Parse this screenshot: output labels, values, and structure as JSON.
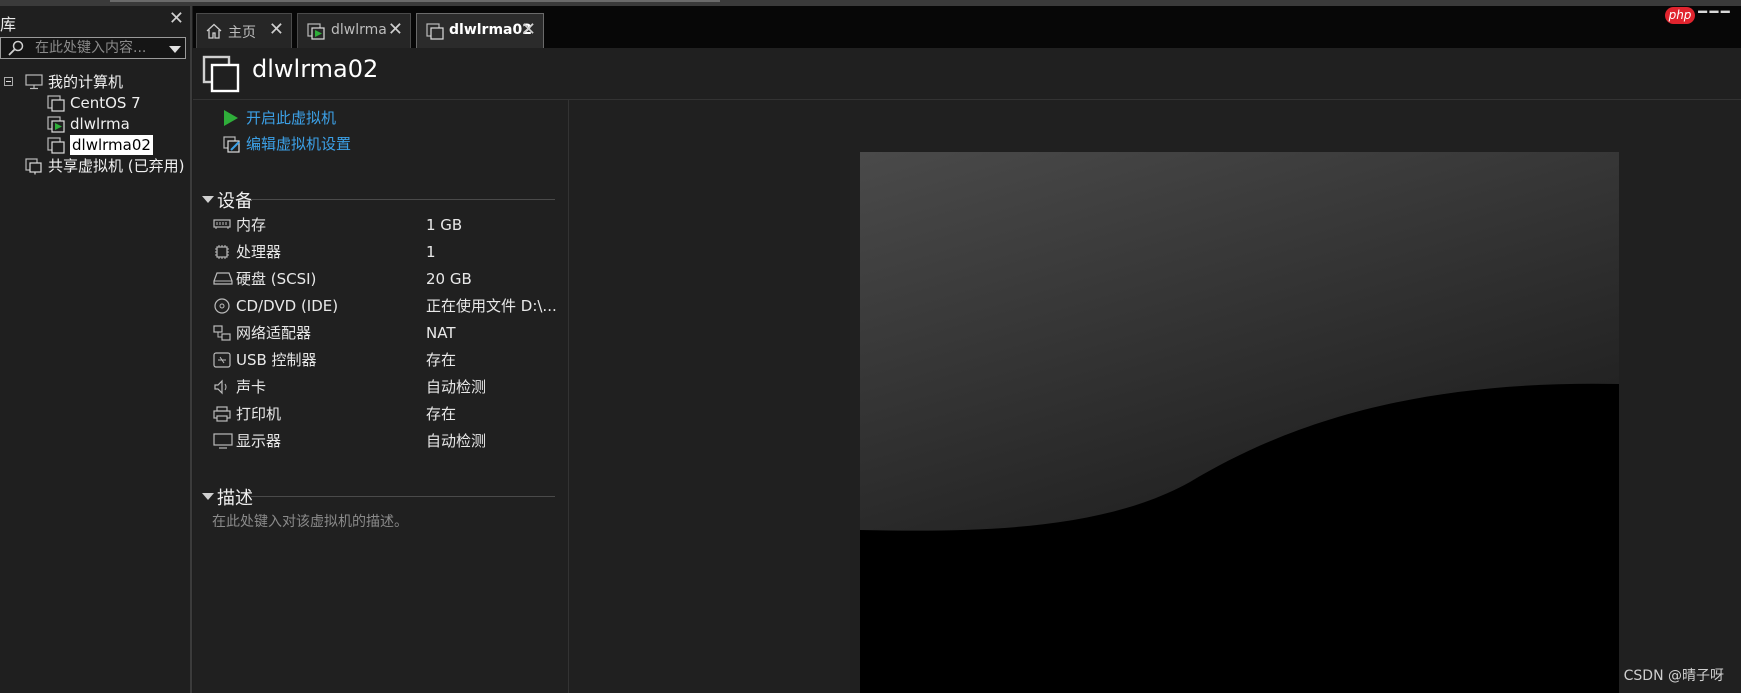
{
  "library": {
    "title": "库",
    "search_placeholder": "在此处键入内容...",
    "tree": [
      {
        "label": "我的计算机",
        "icon": "computer-icon"
      },
      {
        "label": "CentOS 7",
        "icon": "vm-icon"
      },
      {
        "label": "dlwlrma",
        "icon": "vm-running-icon"
      },
      {
        "label": "dlwlrma02",
        "icon": "vm-icon",
        "selected": true
      },
      {
        "label": "共享虚拟机 (已弃用)",
        "icon": "shared-vm-icon"
      }
    ]
  },
  "tabs": [
    {
      "label": "主页",
      "icon": "home-icon"
    },
    {
      "label": "dlwlrma",
      "icon": "vm-running-icon"
    },
    {
      "label": "dlwlrma02",
      "icon": "vm-icon",
      "active": true
    }
  ],
  "vm": {
    "title": "dlwlrma02",
    "actions": {
      "power_on": "开启此虚拟机",
      "edit_settings": "编辑虚拟机设置"
    },
    "devices_header": "设备",
    "devices": [
      {
        "name": "内存",
        "value": "1 GB",
        "icon": "memory-icon"
      },
      {
        "name": "处理器",
        "value": "1",
        "icon": "processor-icon"
      },
      {
        "name": "硬盘 (SCSI)",
        "value": "20 GB",
        "icon": "hard-disk-icon"
      },
      {
        "name": "CD/DVD (IDE)",
        "value": "正在使用文件 D:\\...",
        "icon": "cd-dvd-icon"
      },
      {
        "name": "网络适配器",
        "value": "NAT",
        "icon": "network-adapter-icon"
      },
      {
        "name": "USB 控制器",
        "value": "存在",
        "icon": "usb-icon"
      },
      {
        "name": "声卡",
        "value": "自动检测",
        "icon": "sound-icon"
      },
      {
        "name": "打印机",
        "value": "存在",
        "icon": "printer-icon"
      },
      {
        "name": "显示器",
        "value": "自动检测",
        "icon": "display-icon"
      }
    ],
    "description_header": "描述",
    "description_placeholder": "在此处键入对该虚拟机的描述。"
  },
  "watermark": "CSDN @晴子呀",
  "logo_text": "php",
  "colors": {
    "link": "#3ca0e6",
    "play": "#2fae3a",
    "background": "#202020",
    "tabbar": "#070707"
  }
}
